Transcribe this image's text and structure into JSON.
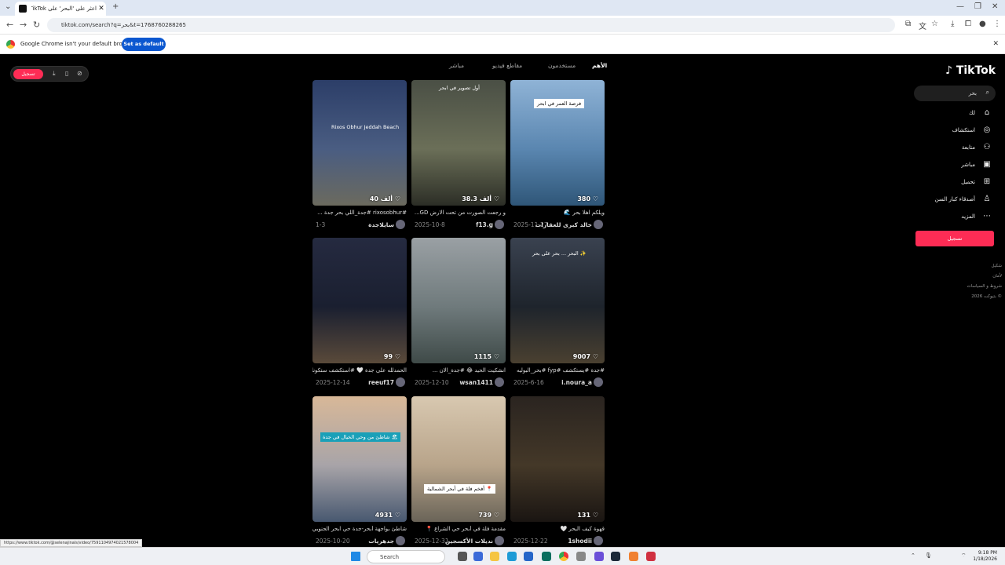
{
  "browser": {
    "tab_title": "اعثر على 'البحر' على TikTok | بحث",
    "url": "tiktok.com/search?q=بحر&t=1768760288265",
    "infobar_text": "Google Chrome isn't your default browser",
    "infobar_button": "Set as default",
    "status_url": "https://www.tiktok.com/@selenajinals/video/7591104974021578004"
  },
  "left_pill": {
    "login_label": "تسجيل"
  },
  "tabs": [
    {
      "label": "الأهم",
      "active": true
    },
    {
      "label": "مستخدمون"
    },
    {
      "label": "مقاطع فيديو"
    },
    {
      "label": "مباشر"
    }
  ],
  "videos": [
    {
      "likes": "380",
      "overlay": "فرصة العمر في ابحر",
      "desc": "ويلكم اهلا بحر 🌊",
      "user": "خالد كبرى للعقارات",
      "date": "2025-11-27",
      "colors": [
        "#8fb3d6",
        "#5a86b0",
        "#2f5678"
      ]
    },
    {
      "likes": "38.3 ألف",
      "overlay": "أول تصوير في ابحر",
      "desc": "و رجعت الصورت من تحت الارض GD...",
      "user": "f13.g",
      "date": "2025-10-8",
      "colors": [
        "#4a4f45",
        "#6b6f58",
        "#2c2e26"
      ]
    },
    {
      "likes": "40 ألف",
      "overlay": "Rixos Obhur Jeddah Beach",
      "desc": "#rixosobhur #جدة_اللي بحر جدة ...",
      "user": "سايلاجدة",
      "date": "1-3",
      "colors": [
        "#2c3e68",
        "#4a5d82",
        "#6b6a5e"
      ]
    },
    {
      "likes": "9007",
      "overlay": "البحر ... بحر على بحر ✨",
      "desc": "#جدة #يستكشف #fyp #بحر_البوليه",
      "user": "i.noura_a",
      "date": "2025-6-16",
      "colors": [
        "#3a4250",
        "#1e242c",
        "#4a4030"
      ]
    },
    {
      "likes": "1115",
      "overlay": "",
      "desc": "انشكيت الحيد 😂 #جدة_الان ...",
      "user": "wsan1411",
      "date": "2025-12-10",
      "colors": [
        "#9aa0a4",
        "#6f7a7c",
        "#3f4a48"
      ]
    },
    {
      "likes": "99",
      "overlay": "",
      "desc": "الحمدلله على جدة 🤍 #استكشف ستكونك",
      "user": "reeuf17",
      "date": "2025-12-14",
      "colors": [
        "#252a40",
        "#1a1f30",
        "#5a4a3a"
      ]
    },
    {
      "likes": "131",
      "overlay": "",
      "desc": "قهوة كيف البحر 🤍",
      "user": "1shodii",
      "date": "2025-12-22",
      "colors": [
        "#2a2420",
        "#443828",
        "#1a1512"
      ]
    },
    {
      "likes": "739",
      "overlay": "أفخم فلة في أبحر الشمالية 📍",
      "desc": "مقدمة فلة في أبحر حي الشراع 📍",
      "user": "نديلات الأكسجين",
      "date": "2025-12-31",
      "colors": [
        "#d8c8b0",
        "#b8a48a",
        "#6a6458"
      ]
    },
    {
      "likes": "4931",
      "overlay": "شاطئ من وحي الخيال في جدة 🏖",
      "desc": "شاطئ بواجهة أبحر-جدة حي ابحر الجنوبي...",
      "user": "جدهريات",
      "date": "2025-10-20",
      "colors": [
        "#d8b898",
        "#a8a4a8",
        "#485870"
      ]
    }
  ],
  "sidebar": {
    "logo": "TikTok",
    "search_query": "بحر",
    "items": [
      {
        "label": "لك",
        "icon": "home-icon"
      },
      {
        "label": "استكشاف",
        "icon": "compass-icon"
      },
      {
        "label": "متابعة",
        "icon": "following-icon"
      },
      {
        "label": "مباشر",
        "icon": "live-icon"
      },
      {
        "label": "تحميل",
        "icon": "upload-icon"
      },
      {
        "label": "أصدقاء كبار السن",
        "icon": "profile-icon"
      },
      {
        "label": "المزيد",
        "icon": "more-icon"
      }
    ],
    "login_button": "تسجيل",
    "footer": [
      "شكيل",
      "لأمان",
      "شروط و السياسات",
      "2026 بتيوكت ©"
    ]
  },
  "taskbar": {
    "search_placeholder": "Search",
    "time": "9:18 PM",
    "date": "1/18/2026"
  }
}
